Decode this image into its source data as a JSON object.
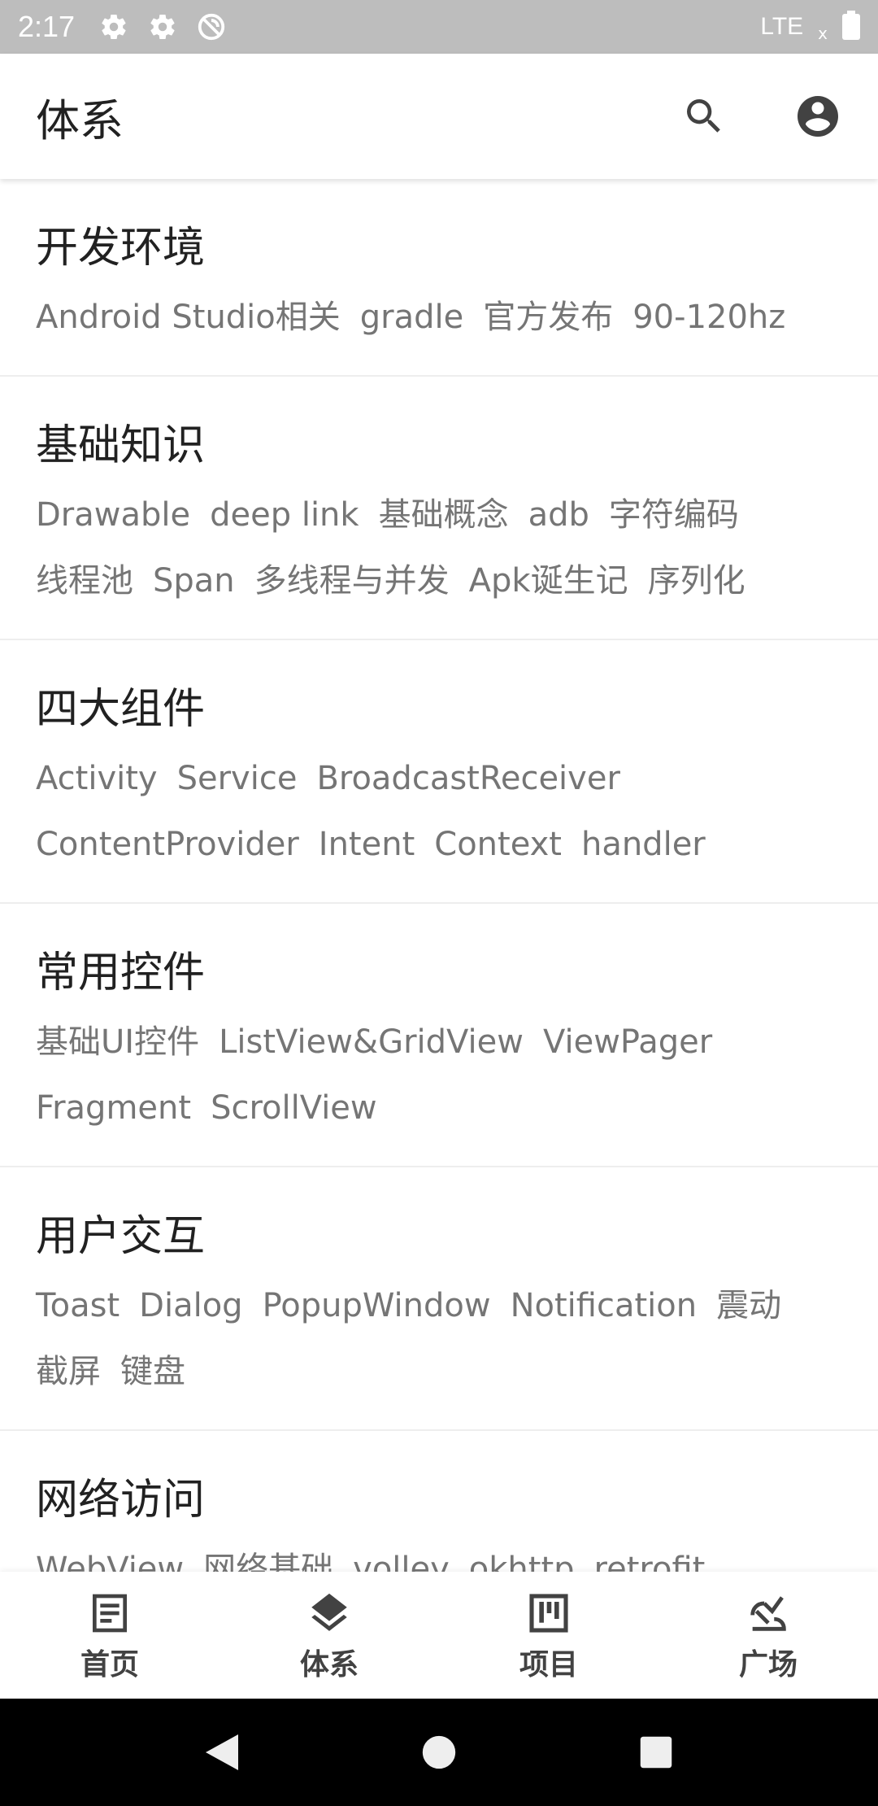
{
  "status_bar": {
    "time": "2:17",
    "network": "LTE",
    "signal_mark": "x",
    "icons": [
      "gear-icon",
      "gear-icon",
      "sync-disabled-icon",
      "battery-icon"
    ]
  },
  "app_bar": {
    "title": "体系",
    "actions": [
      "search-icon",
      "account-icon"
    ]
  },
  "categories": [
    {
      "title": "开发环境",
      "tags": [
        "Android Studio相关",
        "gradle",
        "官方发布",
        "90-120hz"
      ]
    },
    {
      "title": "基础知识",
      "tags": [
        "Drawable",
        "deep link",
        "基础概念",
        "adb",
        "字符编码",
        "线程池",
        "Span",
        "多线程与并发",
        "Apk诞生记",
        "序列化"
      ]
    },
    {
      "title": "四大组件",
      "tags": [
        "Activity",
        "Service",
        "BroadcastReceiver",
        "ContentProvider",
        "Intent",
        "Context",
        "handler"
      ]
    },
    {
      "title": "常用控件",
      "tags": [
        "基础UI控件",
        "ListView&GridView",
        "ViewPager",
        "Fragment",
        "ScrollView"
      ]
    },
    {
      "title": "用户交互",
      "tags": [
        "Toast",
        "Dialog",
        "PopupWindow",
        "Notification",
        "震动",
        "截屏",
        "键盘"
      ]
    },
    {
      "title": "网络访问",
      "tags": [
        "WebView",
        "网络基础",
        "volley",
        "okhttp",
        "retrofit"
      ]
    }
  ],
  "bottom_nav": [
    {
      "label": "首页",
      "icon": "article-icon"
    },
    {
      "label": "体系",
      "icon": "layers-icon"
    },
    {
      "label": "项目",
      "icon": "project-board-icon"
    },
    {
      "label": "广场",
      "icon": "square-plaza-icon"
    }
  ],
  "colors": {
    "status_bar": "#bdbdbd",
    "text_primary": "#212121",
    "text_secondary": "#757575",
    "divider": "#eeeeee"
  }
}
